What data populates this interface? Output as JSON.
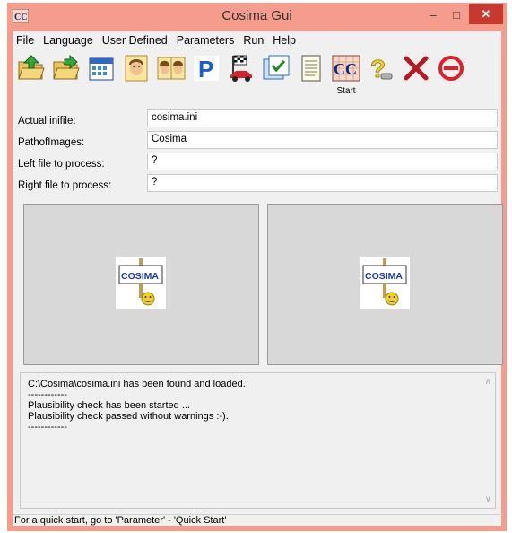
{
  "window": {
    "title": "Cosima Gui",
    "app_icon": "cc-app-icon",
    "controls": {
      "minimize": "–",
      "maximize": "□",
      "close": "✕"
    }
  },
  "menu": [
    "File",
    "Language",
    "User Defined",
    "Parameters",
    "Run",
    "Help"
  ],
  "toolbar": {
    "icons": [
      "folder-open-green-icon",
      "folder-open-alt-icon",
      "calendar-icon",
      "face-single-icon",
      "face-pair-icon",
      "parking-p-icon",
      "race-car-icon",
      "checklist-icon",
      "notepad-icon",
      "cc-start-icon",
      "help-question-icon",
      "delete-x-icon",
      "stop-icon"
    ],
    "start_label": "Start"
  },
  "fields": {
    "actual_infile": {
      "label": "Actual inifile:",
      "value": "cosima.ini"
    },
    "path_of_images": {
      "label": "PathofImages:",
      "value": "Cosima"
    },
    "left_file": {
      "label": "Left file to process:",
      "value": "?"
    },
    "right_file": {
      "label": "Right file to process:",
      "value": "?"
    }
  },
  "panels": {
    "left_logo_text": "COSIMA",
    "right_logo_text": "COSIMA"
  },
  "log": [
    "C:\\Cosima\\cosima.ini has been found and loaded.",
    "------------",
    "Plausibility check has been started ...",
    "Plausibility check passed without warnings :-).",
    "------------"
  ],
  "status": "For a quick start, go to 'Parameter' - 'Quick Start'",
  "colors": {
    "title_bar": "#f59c8c",
    "close_button": "#c7382f",
    "panel_bg": "#d8d8d8"
  }
}
